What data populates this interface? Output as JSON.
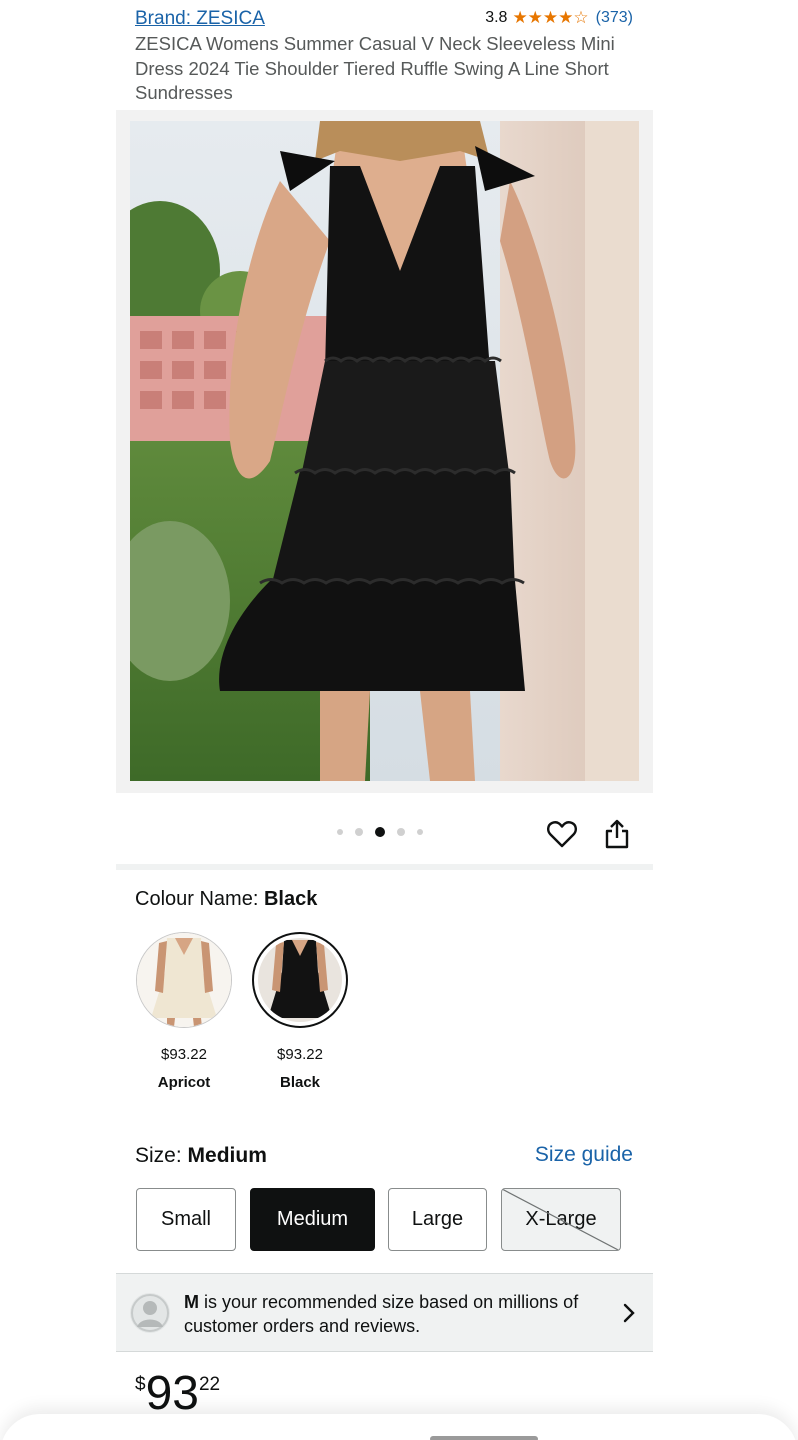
{
  "header": {
    "brand_link": "Brand: ZESICA",
    "rating_value": "3.8",
    "rating_stars": 3.8,
    "rating_count": "(373)",
    "title": "ZESICA Womens Summer Casual V Neck Sleeveless Mini Dress 2024 Tie Shoulder Tiered Ruffle Swing A Line Short Sundresses"
  },
  "carousel": {
    "total_images": 5,
    "active_index": 2
  },
  "colour": {
    "label": "Colour Name:",
    "selected": "Black",
    "options": [
      {
        "name": "Apricot",
        "price": "$93.22",
        "swatch_color": "#efe6d2"
      },
      {
        "name": "Black",
        "price": "$93.22",
        "swatch_color": "#111111"
      }
    ]
  },
  "size": {
    "label": "Size:",
    "selected": "Medium",
    "guide_link": "Size guide",
    "options": [
      {
        "label": "Small",
        "state": "available"
      },
      {
        "label": "Medium",
        "state": "selected"
      },
      {
        "label": "Large",
        "state": "available"
      },
      {
        "label": "X-Large",
        "state": "unavailable"
      }
    ]
  },
  "recommendation": {
    "size_letter": "M",
    "text": "is your recommended size based on millions of customer orders and reviews."
  },
  "price": {
    "symbol": "$",
    "whole": "93",
    "fraction": "22"
  },
  "colors": {
    "link": "#1a63a8",
    "star": "#e77600",
    "dress": "#111111"
  }
}
